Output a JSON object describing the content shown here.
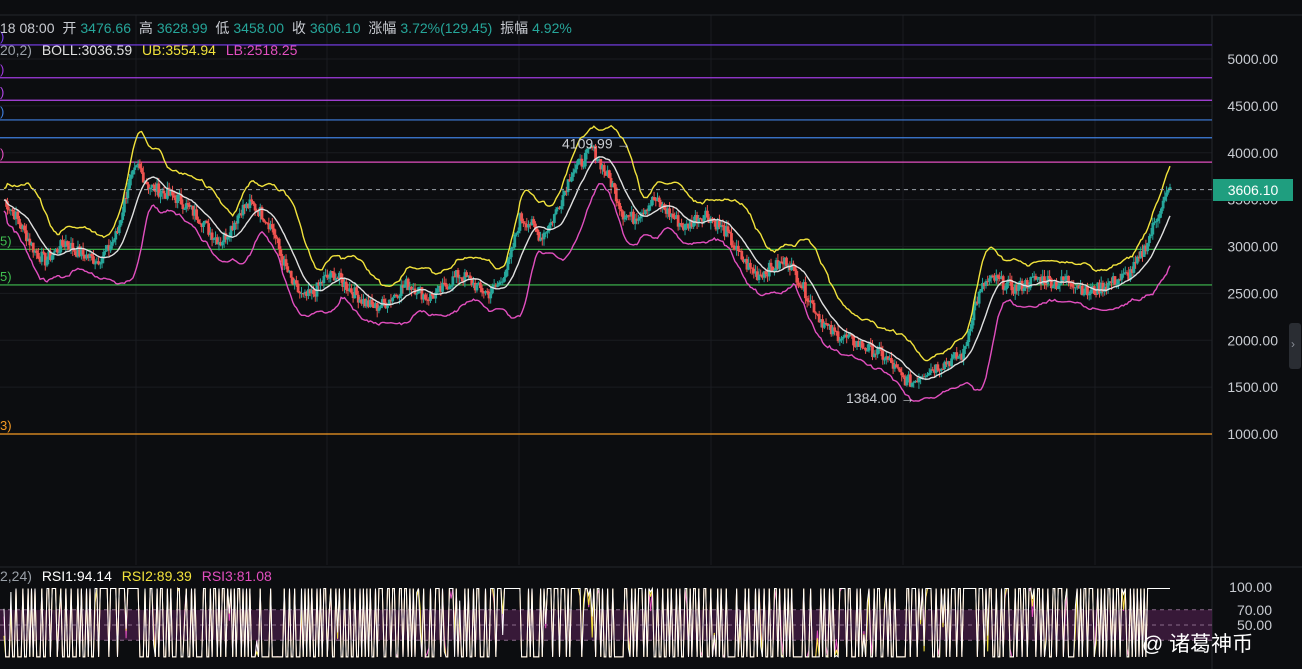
{
  "ohlc": {
    "time": "18 08:00",
    "open_label": "开",
    "open": "3476.66",
    "high_label": "高",
    "high": "3628.99",
    "low_label": "低",
    "low": "3458.00",
    "close_label": "收",
    "close": "3606.10",
    "change_label": "涨幅",
    "change": "3.72%(129.45)",
    "amp_label": "振幅",
    "amp": "4.92%"
  },
  "boll": {
    "params": "20,2)",
    "boll_label": "BOLL:3036.59",
    "ub_label": "UB:3554.94",
    "lb_label": "LB:2518.25"
  },
  "rsi": {
    "params": "2,24)",
    "rsi1": "RSI1:94.14",
    "rsi2": "RSI2:89.39",
    "rsi3": "RSI3:81.08"
  },
  "current_price": "3606.10",
  "watermark": "@ 诸葛神币",
  "colors": {
    "background": "#0c0d10",
    "up": "#26a69a",
    "down": "#ef5350",
    "boll_mid": "#e0e0e0",
    "boll_ub": "#f2e33c",
    "boll_lb": "#e24fbf",
    "rsi1": "#ffffff",
    "rsi2": "#f2e33c",
    "rsi3": "#e24fbf",
    "rsi_band": "#4a1f4a",
    "price_tag": "#1f9e7f"
  },
  "chart_data": {
    "type": "candlestick",
    "y_axis_ticks": [
      "5000.00",
      "4500.00",
      "4000.00",
      "3500.00",
      "3000.00",
      "2500.00",
      "2000.00",
      "1500.00",
      "1000.00"
    ],
    "ylim": [
      500,
      5200
    ],
    "rsi_ticks": [
      "100.00",
      "70.00",
      "50.00"
    ],
    "horizontal_levels": [
      {
        "price": 5150,
        "color": "#7b3ff2",
        "label": ")"
      },
      {
        "price": 4800,
        "color": "#a03ae0",
        "label": ")"
      },
      {
        "price": 4560,
        "color": "#b246e8",
        "label": ")"
      },
      {
        "price": 4350,
        "color": "#3f7fe0",
        "label": ")"
      },
      {
        "price": 4160,
        "color": "#3f7fe0",
        "label": ""
      },
      {
        "price": 3900,
        "color": "#e24fbf",
        "label": ")"
      },
      {
        "price": 2970,
        "color": "#3fbf4f",
        "label": "5)"
      },
      {
        "price": 2590,
        "color": "#3fbf4f",
        "label": "5)"
      },
      {
        "price": 1000,
        "color": "#f59a23",
        "label": "3)"
      }
    ],
    "annotations": [
      {
        "text": "4109.99",
        "price": 4109.99
      },
      {
        "text": "1384.00",
        "price": 1384.0
      }
    ],
    "close_series": [
      3500,
      3350,
      3150,
      2950,
      2850,
      2950,
      3050,
      2950,
      2900,
      2850,
      2950,
      3150,
      3650,
      3850,
      3650,
      3600,
      3550,
      3500,
      3400,
      3300,
      3150,
      3050,
      3200,
      3400,
      3450,
      3350,
      3200,
      2850,
      2600,
      2450,
      2500,
      2650,
      2700,
      2600,
      2500,
      2400,
      2350,
      2400,
      2500,
      2600,
      2550,
      2450,
      2500,
      2600,
      2700,
      2650,
      2550,
      2500,
      2600,
      2850,
      3300,
      3250,
      3100,
      3250,
      3500,
      3800,
      3900,
      4050,
      3850,
      3650,
      3350,
      3300,
      3400,
      3500,
      3400,
      3300,
      3200,
      3300,
      3350,
      3250,
      3150,
      2950,
      2800,
      2700,
      2750,
      2800,
      2850,
      2650,
      2450,
      2250,
      2100,
      2050,
      2000,
      1950,
      1900,
      1850,
      1750,
      1600,
      1550,
      1650,
      1700,
      1750,
      1800,
      1850,
      2350,
      2600,
      2650,
      2600,
      2550,
      2600,
      2650,
      2650,
      2600,
      2650,
      2600,
      2500,
      2550,
      2600,
      2650,
      2700,
      2850,
      3100,
      3400,
      3606
    ]
  }
}
